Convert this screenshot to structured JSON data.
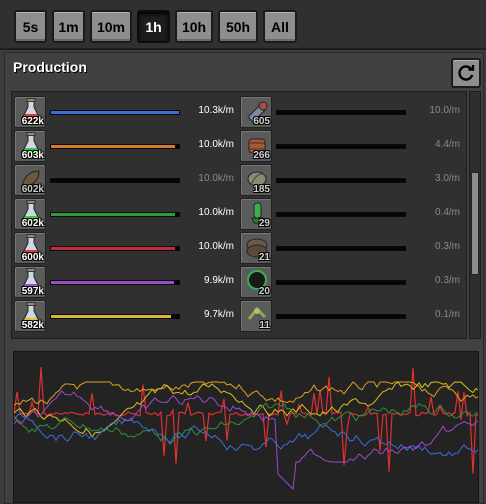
{
  "toolbar": {
    "buttons": [
      {
        "label": "5s"
      },
      {
        "label": "1m"
      },
      {
        "label": "10m"
      },
      {
        "label": "1h",
        "active": true
      },
      {
        "label": "10h"
      },
      {
        "label": "50h"
      },
      {
        "label": "All"
      }
    ]
  },
  "panel": {
    "title": "Production",
    "refresh_icon": "refresh-icon"
  },
  "left_items": [
    {
      "icon": "automation-science-pack-icon",
      "color": "#d63a3a",
      "count": "622k",
      "rate": "10.3k/m",
      "fill_fraction": 1.0,
      "bar_color": "#3a6ed6"
    },
    {
      "icon": "logistic-science-pack-icon",
      "color": "#3ac94a",
      "count": "603k",
      "rate": "10.0k/m",
      "fill_fraction": 0.97,
      "bar_color": "#d6792a"
    },
    {
      "icon": "rocket-fuel-icon",
      "color": "#7a6a4a",
      "count": "602k",
      "rate": "10.0k/m",
      "fill_fraction": 0.0,
      "bar_color": "#444444",
      "dim": true
    },
    {
      "icon": "chemical-science-pack-icon",
      "color": "#3ac94a",
      "count": "602k",
      "rate": "10.0k/m",
      "fill_fraction": 0.97,
      "bar_color": "#2e9a3a"
    },
    {
      "icon": "military-science-pack-icon",
      "color": "#d63a3a",
      "count": "600k",
      "rate": "10.0k/m",
      "fill_fraction": 0.97,
      "bar_color": "#c42a3a"
    },
    {
      "icon": "production-science-pack-icon",
      "color": "#a04ad6",
      "count": "597k",
      "rate": "9.9k/m",
      "fill_fraction": 0.96,
      "bar_color": "#9b4ac9"
    },
    {
      "icon": "utility-science-pack-icon",
      "color": "#e0c23a",
      "count": "582k",
      "rate": "9.7k/m",
      "fill_fraction": 0.94,
      "bar_color": "#d6b82a"
    }
  ],
  "right_items": [
    {
      "icon": "artillery-shell-icon",
      "count": "605",
      "rate": "10.0/m"
    },
    {
      "icon": "empty-barrel-icon",
      "count": "266",
      "rate": "4.4/m"
    },
    {
      "icon": "raw-fish-icon",
      "count": "185",
      "rate": "3.0/m"
    },
    {
      "icon": "poison-capsule-icon",
      "count": "29",
      "rate": "0.4/m"
    },
    {
      "icon": "rail-chain-signal-icon",
      "count": "21",
      "rate": "0.3/m"
    },
    {
      "icon": "nuclear-fuel-icon",
      "count": "20",
      "rate": "0.3/m"
    },
    {
      "icon": "spidertron-remote-icon",
      "count": "11",
      "rate": "0.1/m"
    }
  ],
  "colors": {
    "background": "#3c3c3c",
    "panel": "#414141",
    "button": "#8e8e8e",
    "active_button": "#1d1d1d"
  },
  "scrollbar": {
    "position_fraction": 0.56,
    "visible_fraction": 0.42
  },
  "graph": {
    "series": [
      {
        "color": "#e03030"
      },
      {
        "color": "#e0a020"
      },
      {
        "color": "#d6c020"
      },
      {
        "color": "#3a8a3a"
      },
      {
        "color": "#3a6ed6"
      },
      {
        "color": "#9b4ac9"
      }
    ]
  }
}
